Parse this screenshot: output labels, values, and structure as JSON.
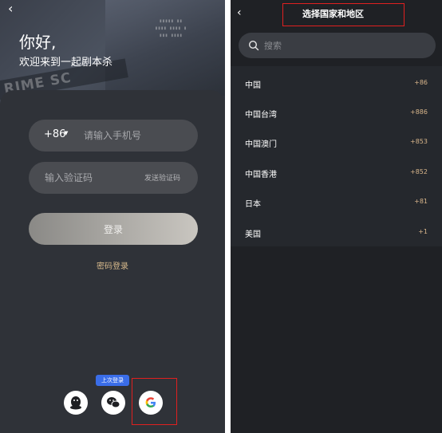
{
  "login": {
    "greeting": "你好,",
    "welcome": "欢迎来到一起剧本杀",
    "hero_tape_text": "RIME SC",
    "country_code": "+86",
    "phone_placeholder": "请输入手机号",
    "code_placeholder": "输入验证码",
    "send_code_label": "发送验证码",
    "login_button": "登录",
    "password_login": "密码登录",
    "last_login_badge": "上次登录",
    "social": [
      "qq",
      "wechat",
      "google"
    ]
  },
  "region_picker": {
    "title": "选择国家和地区",
    "search_placeholder": "搜索",
    "regions": [
      {
        "name": "中国",
        "code": "+86"
      },
      {
        "name": "中国台湾",
        "code": "+886"
      },
      {
        "name": "中国澳门",
        "code": "+853"
      },
      {
        "name": "中国香港",
        "code": "+852"
      },
      {
        "name": "日本",
        "code": "+81"
      },
      {
        "name": "美国",
        "code": "+1"
      }
    ]
  },
  "colors": {
    "accent_gold": "#d9b68b",
    "badge_blue": "#3a6de8",
    "highlight_red": "#e02020",
    "dark_bg": "#1f2125"
  }
}
